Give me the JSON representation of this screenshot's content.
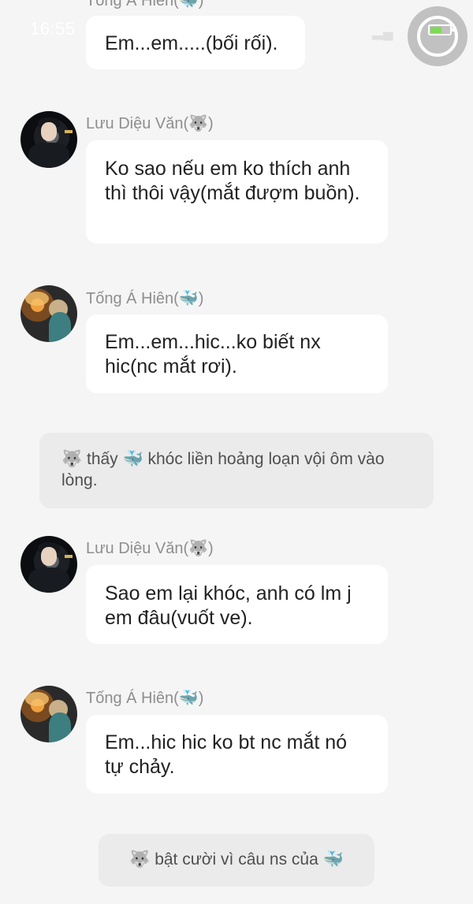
{
  "status_bar": {
    "time": "16:55"
  },
  "messages": [
    {
      "type": "message",
      "sender": "Tống Á Hiên(🐳)",
      "character": "fish",
      "text": "Em...em.....(bối rối)."
    },
    {
      "type": "message",
      "sender": "Lưu Diệu Văn(🐺)",
      "character": "wolf",
      "text": "Ko sao nếu em ko thích anh thì thôi vậy(mắt đượm buồn)."
    },
    {
      "type": "message",
      "sender": "Tống Á Hiên(🐳)",
      "character": "fish",
      "text": "Em...em...hic...ko biết nx hic(nc mắt rơi)."
    },
    {
      "type": "narration",
      "text": "🐺 thấy 🐳 khóc liền hoảng loạn vội ôm vào lòng."
    },
    {
      "type": "message",
      "sender": "Lưu Diệu Văn(🐺)",
      "character": "wolf",
      "text": "Sao em lại khóc, anh có lm j em đâu(vuốt ve)."
    },
    {
      "type": "message",
      "sender": "Tống Á Hiên(🐳)",
      "character": "fish",
      "text": "Em...hic hic ko bt nc mắt nó tự chảy."
    },
    {
      "type": "narration",
      "text": "🐺 bật cười vì câu ns của 🐳"
    }
  ],
  "colors": {
    "background": "#f5f5f5",
    "bubble": "#ffffff",
    "narration_bg": "#ebebeb",
    "name": "#8e8e8e"
  }
}
